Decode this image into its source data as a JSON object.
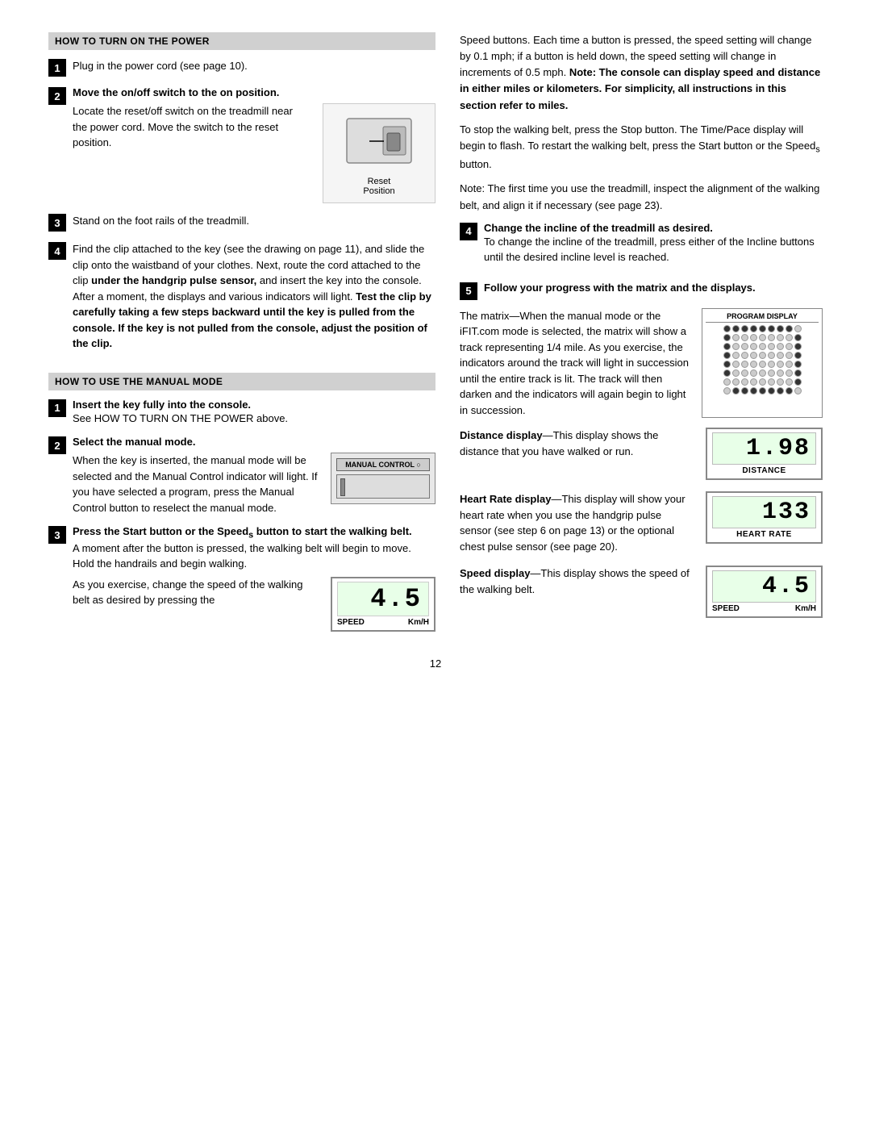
{
  "page": {
    "number": "12"
  },
  "section1": {
    "header": "HOW TO TURN ON THE POWER",
    "step1": {
      "text": "Plug in the power cord (see page 10)."
    },
    "step2": {
      "bold": "Move the on/off switch to the on position.",
      "text": "Locate the reset/off switch on the treadmill near the power cord. Move the switch to the reset position.",
      "diagram_label": "Reset\nPosition"
    },
    "step3": {
      "text": "Stand on the foot rails of the treadmill."
    },
    "step4": {
      "text": "Find the clip attached to the key (see the drawing on page 11), and slide the clip onto the waistband of your clothes. Next, route the cord attached to the clip ",
      "bold_mid": "under the handgrip pulse sensor,",
      "text2": " and insert the key into the console. After a moment, the displays and various indicators will light. ",
      "bold_end": "Test the clip by carefully taking a few steps backward until the key is pulled from the console. If the key is not pulled from the console, adjust the position of the clip."
    }
  },
  "section2": {
    "header": "HOW TO USE THE MANUAL MODE",
    "step1": {
      "bold": "Insert the key fully into the console.",
      "text": "See HOW TO TURN ON THE POWER above."
    },
    "step2": {
      "bold": "Select the manual mode.",
      "text": "When the key is inserted, the manual mode will be selected and the Manual Control indicator will light. If you have selected a program, press the Manual Control button to reselect the manual mode.",
      "diagram_label": "MANUAL CONTROL"
    },
    "step3": {
      "bold": "Press the Start button or the Speed",
      "sub": "s",
      "bold2": " button to start the walking belt.",
      "text": "A moment after the button is pressed, the walking belt will begin to move. Hold the handrails and begin walking.",
      "text2": "As you exercise, change the speed of the walking belt as desired by pressing the",
      "speed_display": {
        "value": "4.5",
        "label_left": "SPEED",
        "label_right": "Km/H"
      }
    }
  },
  "right_col": {
    "para1": "Speed buttons. Each time a button is pressed, the speed setting will change by 0.1 mph; if a button is held down, the speed setting will change in increments of 0.5 mph. ",
    "para1_bold": "Note: The console can display speed and distance in either miles or kilometers. For simplicity, all instructions in this section refer to miles.",
    "para2": "To stop the walking belt, press the Stop button. The Time/Pace display will begin to flash. To restart the walking belt, press the Start button or the Speed",
    "para2_sub": "s",
    "para2_end": " button.",
    "para3": "Note: The first time you use the treadmill, inspect the alignment of the walking belt, and align it if necessary (see page 23).",
    "step4": {
      "bold": "Change the incline of the treadmill as desired.",
      "text": "To change the incline of the treadmill, press either of the Incline buttons until the desired incline level is reached."
    },
    "step5": {
      "bold": "Follow your progress with the matrix and the displays.",
      "matrix_text": "The matrix—When the manual mode or the iFIT.com mode is selected, the matrix will show a track representing 1/4 mile. As you exercise, the indicators around the track will light in succession until the entire track is lit. The track will then darken and the indicators will again begin to light in succession.",
      "program_display_header": "PROGRAM DISPLAY",
      "distance_display": {
        "label_bold": "Distance display",
        "label_dash": "—This display shows the distance that you have walked or run.",
        "value": "1.98",
        "dlabel": "DISTANCE"
      },
      "heart_rate_display": {
        "label_bold": "Heart Rate display",
        "label_dash": "—This display will show your heart rate when you use the handgrip pulse sensor (see step 6 on page 13) or the optional chest pulse sensor (see page 20).",
        "value": "133",
        "dlabel": "HEART RATE"
      },
      "speed_display2": {
        "label_bold": "Speed display",
        "label_dash": "—This display shows the speed of the walking belt.",
        "value": "4.5",
        "label_left": "SPEED",
        "label_right": "Km/H"
      }
    }
  }
}
